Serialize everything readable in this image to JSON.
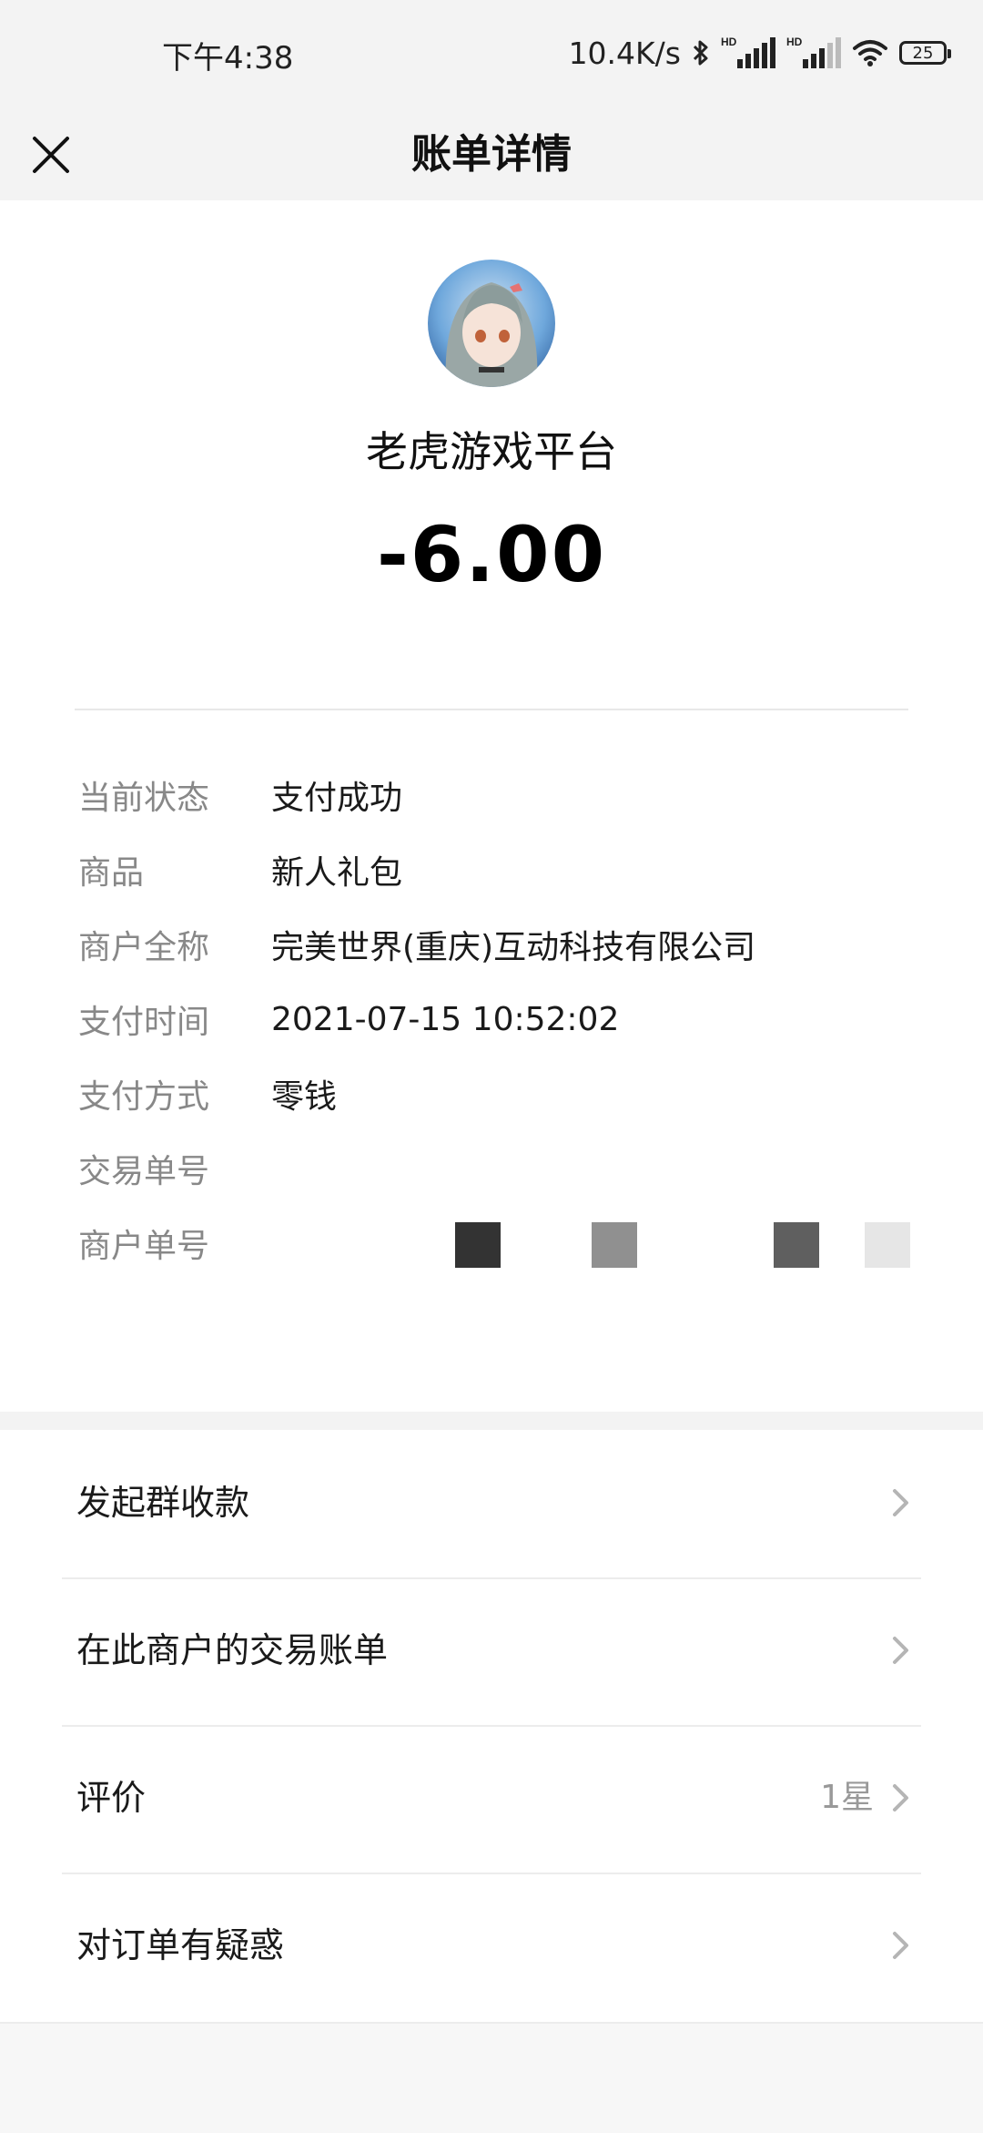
{
  "status_bar": {
    "time": "下午4:38",
    "network_speed": "10.4K/s",
    "battery": "25",
    "icons": [
      "bluetooth-icon",
      "hd-signal-icon",
      "hd-signal-icon",
      "wifi-icon",
      "battery-icon"
    ]
  },
  "nav": {
    "title": "账单详情",
    "close_icon": "close-icon"
  },
  "merchant": {
    "name": "老虎游戏平台",
    "amount": "-6.00"
  },
  "details": [
    {
      "label": "当前状态",
      "value": "支付成功"
    },
    {
      "label": "商品",
      "value": "新人礼包"
    },
    {
      "label": "商户全称",
      "value": "完美世界(重庆)互动科技有限公司"
    },
    {
      "label": "支付时间",
      "value": "2021-07-15 10:52:02"
    },
    {
      "label": "支付方式",
      "value": "零钱"
    },
    {
      "label": "交易单号",
      "value": ""
    },
    {
      "label": "商户单号",
      "value": ""
    }
  ],
  "menu": [
    {
      "label": "发起群收款",
      "value": ""
    },
    {
      "label": "在此商户的交易账单",
      "value": ""
    },
    {
      "label": "评价",
      "value": "1星"
    },
    {
      "label": "对订单有疑惑",
      "value": ""
    }
  ],
  "colors": {
    "background": "#f3f3f3",
    "card": "#ffffff",
    "label_gray": "#888888",
    "text": "#1a1a1a"
  }
}
